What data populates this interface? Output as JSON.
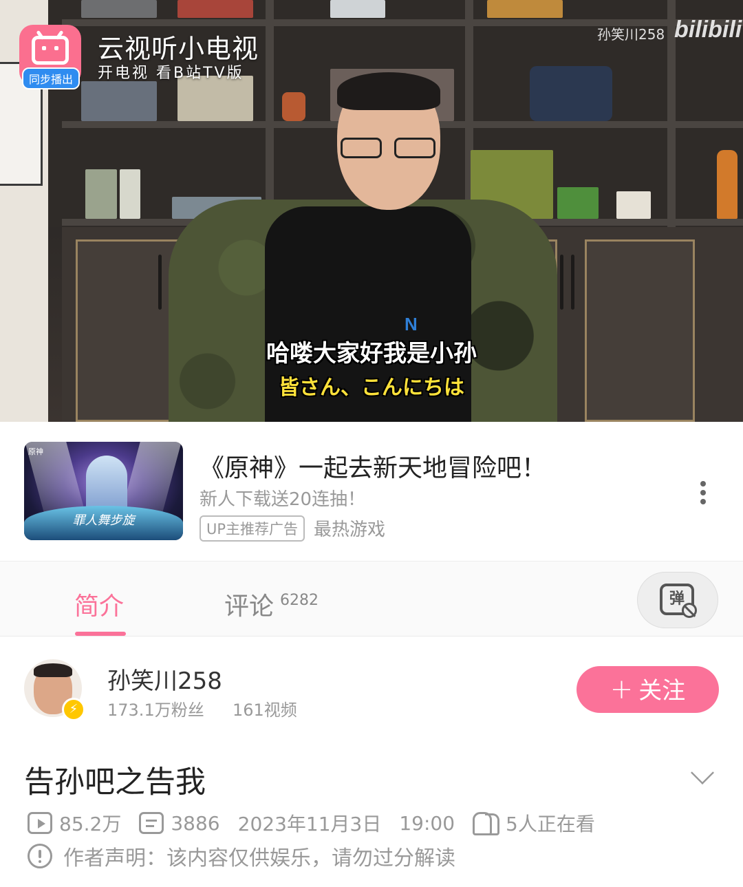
{
  "player": {
    "promo_title": "云视听小电视",
    "promo_subtitle": "开电视 看B站TV版",
    "sync_badge": "同步播出",
    "watermark_user": "孙笑川258",
    "watermark_logo": "bilibili",
    "shirt_brand": "N",
    "subtitle_zh": "哈喽大家好我是小孙",
    "subtitle_ja": "皆さん、こんにちは"
  },
  "ad": {
    "thumb_game_tag": "原神",
    "thumb_caption": "罪人舞步旋",
    "title": "《原神》一起去新天地冒险吧！",
    "subtitle": "新人下载送20连抽！",
    "tag": "UP主推荐广告",
    "category": "最热游戏"
  },
  "tabs": {
    "intro": "简介",
    "comments": "评论",
    "comment_count": "6282",
    "danmaku_glyph": "弹"
  },
  "uploader": {
    "name": "孙笑川258",
    "fans": "173.1万粉丝",
    "videos": "161视频",
    "follow_label": "关注",
    "follow_plus": "+",
    "verify_glyph": "⚡"
  },
  "video": {
    "title": "告孙吧之告我",
    "views": "85.2万",
    "danmaku": "3886",
    "date": "2023年11月3日",
    "time": "19:00",
    "watching": "5人正在看",
    "notice": "作者声明：该内容仅供娱乐，请勿过分解读"
  },
  "colors": {
    "accent": "#fb7299",
    "badge_blue": "#2f8cf0",
    "verify_yellow": "#ffc700",
    "subtitle_yellow": "#ffe23a"
  },
  "icons": [
    "app-tv-icon",
    "more-vertical-icon",
    "danmaku-off-icon",
    "verified-bolt-icon",
    "chevron-down-icon",
    "play-count-icon",
    "danmaku-count-icon",
    "viewers-icon",
    "notice-icon"
  ]
}
